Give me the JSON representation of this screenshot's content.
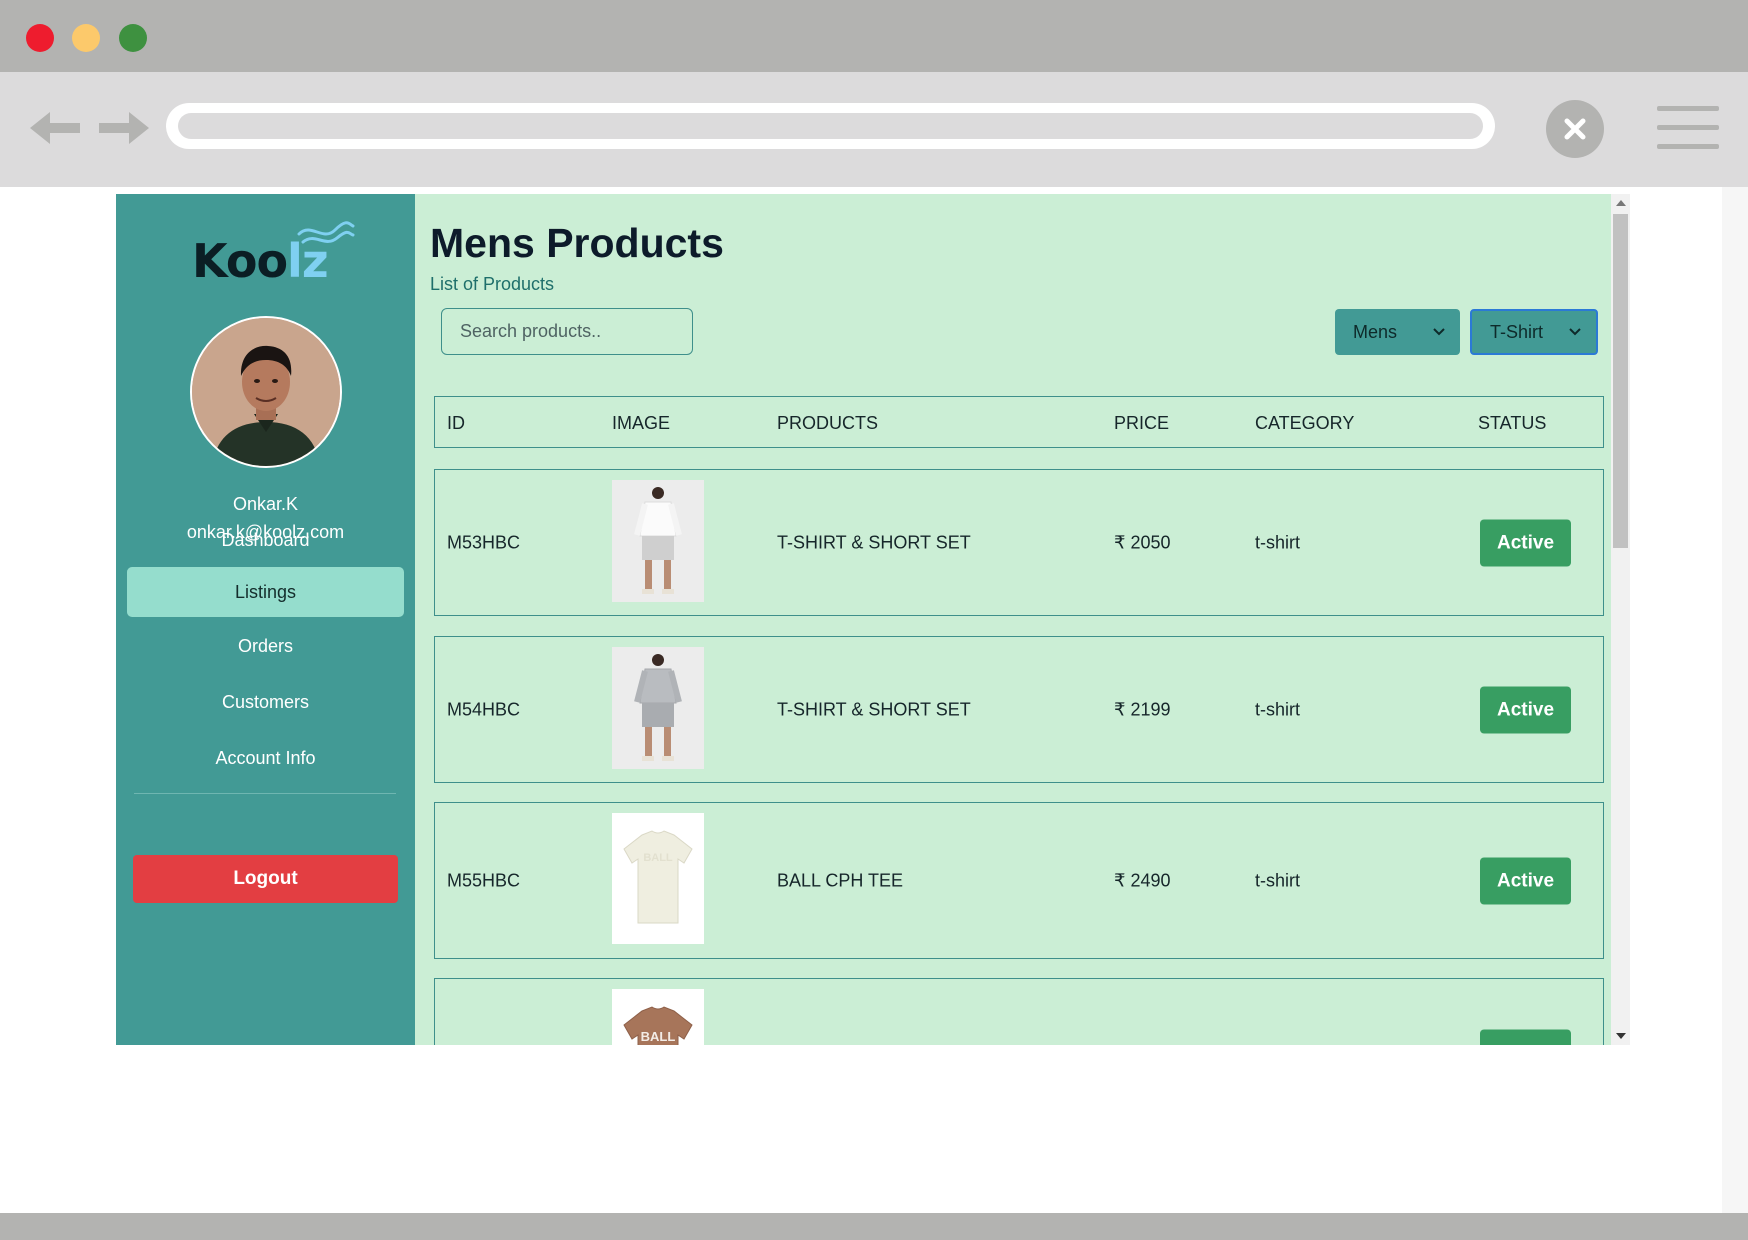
{
  "window": {
    "controls": [
      "close-dot",
      "minimize-dot",
      "maximize-dot"
    ],
    "colors": {
      "titlebar": "#b3b3b1",
      "toolbar": "#dcdbdc",
      "close": "#ee1c2e",
      "minimize": "#fcc96b",
      "maximize": "#3e9140"
    }
  },
  "brand": {
    "logo_main": "Koo",
    "logo_accent": "lz",
    "colors": {
      "dark": "#0b1e24",
      "accent": "#7fd0f1"
    }
  },
  "user": {
    "name": "Onkar.K",
    "email": "onkar.k@koolz.com"
  },
  "sidebar": {
    "items": [
      {
        "label": "Dashboard",
        "active": false
      },
      {
        "label": "Listings",
        "active": true
      },
      {
        "label": "Orders",
        "active": false
      },
      {
        "label": "Customers",
        "active": false
      },
      {
        "label": "Account Info",
        "active": false
      }
    ],
    "logout_label": "Logout",
    "colors": {
      "background": "#429a95",
      "active": "#95ddcd",
      "logout": "#e33e42"
    }
  },
  "main": {
    "title": "Mens Products",
    "subtitle": "List of Products",
    "search": {
      "placeholder": "Search products..",
      "value": ""
    },
    "filters": {
      "gender": "Mens",
      "category": "T-Shirt"
    },
    "table": {
      "headers": [
        "ID",
        "IMAGE",
        "PRODUCTS",
        "PRICE",
        "CATEGORY",
        "STATUS"
      ],
      "rows": [
        {
          "id": "M53HBC",
          "image": "model-white-tshirt-shorts",
          "product": "T-SHIRT & SHORT SET",
          "price": "₹ 2050",
          "category": "t-shirt",
          "status": "Active"
        },
        {
          "id": "M54HBC",
          "image": "model-grey-tshirt-shorts",
          "product": "T-SHIRT & SHORT SET",
          "price": "₹ 2199",
          "category": "t-shirt",
          "status": "Active"
        },
        {
          "id": "M55HBC",
          "image": "cream-ball-tee",
          "product": "BALL CPH TEE",
          "price": "₹ 2490",
          "category": "t-shirt",
          "status": "Active"
        },
        {
          "id": "",
          "image": "brown-ball-tee",
          "product": "",
          "price": "",
          "category": "",
          "status": ""
        }
      ]
    },
    "colors": {
      "background": "#cbeed5",
      "border": "#3e8f8b",
      "status_active": "#389e62"
    }
  }
}
